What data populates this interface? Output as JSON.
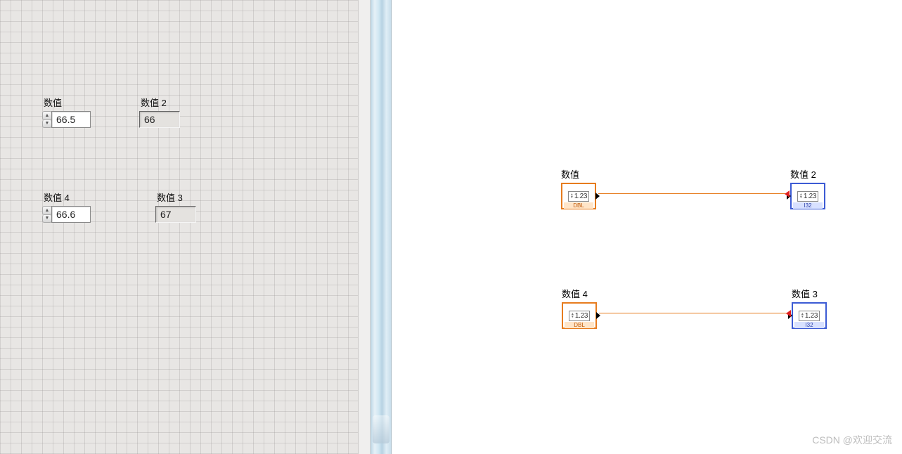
{
  "front_panel": {
    "controls": {
      "ctrl1": {
        "label": "数值",
        "value": "66.5"
      },
      "ctrl2": {
        "label": "数值 4",
        "value": "66.6"
      }
    },
    "indicators": {
      "ind1": {
        "label": "数值 2",
        "value": "66"
      },
      "ind2": {
        "label": "数值 3",
        "value": "67"
      }
    }
  },
  "block_diagram": {
    "nodes": {
      "n1": {
        "label": "数值",
        "display": "1.23",
        "foot": "DBL"
      },
      "n2": {
        "label": "数值 2",
        "display": "1.23",
        "foot": "I32"
      },
      "n3": {
        "label": "数值 4",
        "display": "1.23",
        "foot": "DBL"
      },
      "n4": {
        "label": "数值 3",
        "display": "1.23",
        "foot": "I32"
      }
    }
  },
  "watermark": "CSDN @欢迎交流"
}
